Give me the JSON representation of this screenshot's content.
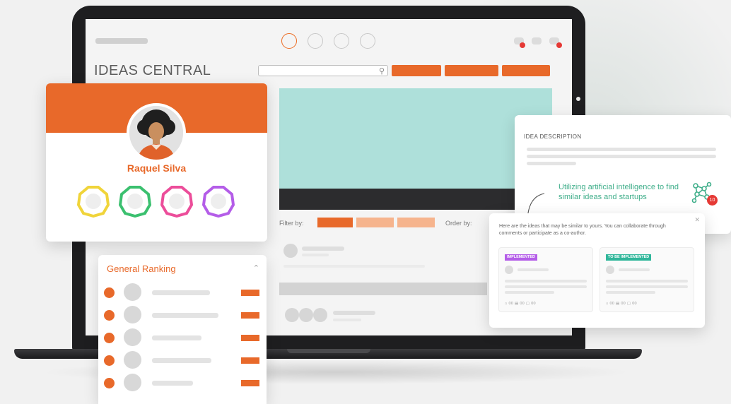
{
  "app": {
    "title": "IDEAS CENTRAL",
    "search_placeholder": ""
  },
  "filters": {
    "filter_label": "Filter by:",
    "order_label": "Order by:"
  },
  "profile": {
    "name": "Raquel Silva",
    "badge_colors": [
      "#f0d43a",
      "#3bc06f",
      "#ec4d9a",
      "#b45de8"
    ]
  },
  "ranking": {
    "title": "General Ranking",
    "rows": 5
  },
  "idea": {
    "title": "IDEA DESCRIPTION",
    "ai_text": "Utilizing artificial intelligence to find similar ideas and startups",
    "similar_count": "10"
  },
  "similar": {
    "description": "Here are the ideas that may be similar to yours. You can collaborate through comments or participate as a co-author.",
    "cards": [
      {
        "tag": "IMPLEMENTED",
        "tag_color": "#b45de8",
        "stats": "⌂ 00   ▤ 00   ▢ 00"
      },
      {
        "tag": "TO BE IMPLEMENTED",
        "tag_color": "#2fb69a",
        "stats": "⌂ 00   ▤ 00   ▢ 00"
      }
    ]
  },
  "colors": {
    "accent": "#e8692a",
    "ai_green": "#3fae8a",
    "video": "#aee0da"
  }
}
